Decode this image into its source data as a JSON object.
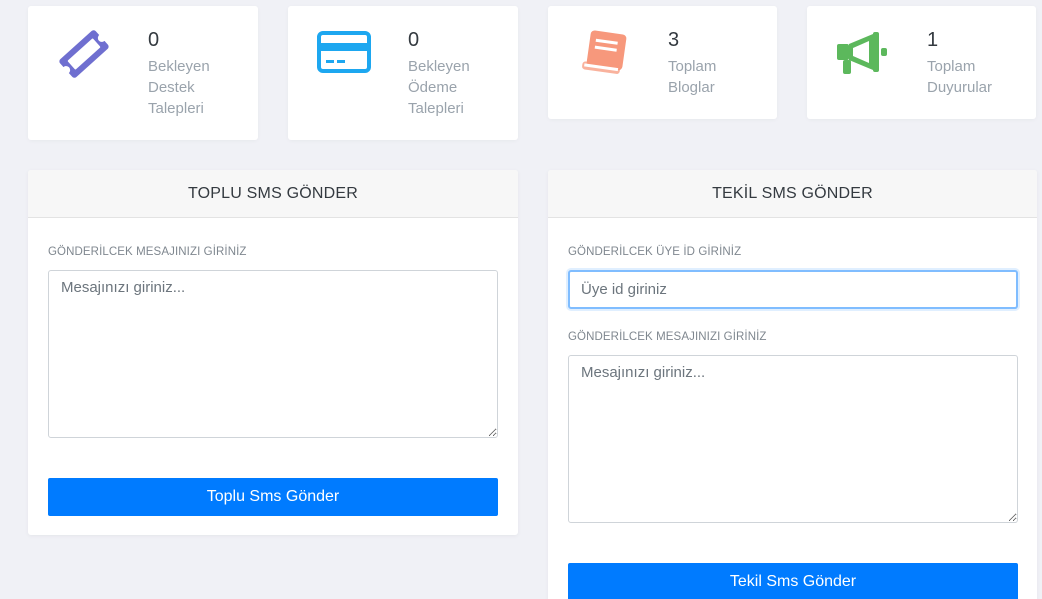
{
  "stats": [
    {
      "value": "0",
      "label_lines": [
        "Bekleyen",
        "Destek",
        "Talepleri"
      ],
      "icon": "ticket-icon",
      "color": "#6f6fd0"
    },
    {
      "value": "0",
      "label_lines": [
        "Bekleyen",
        "Ödeme",
        "Talepleri"
      ],
      "icon": "credit-card-icon",
      "color": "#1da7f0"
    },
    {
      "value": "3",
      "label_lines": [
        "Toplam",
        "Bloglar"
      ],
      "icon": "book-icon",
      "color": "#f7987c"
    },
    {
      "value": "1",
      "label_lines": [
        "Toplam",
        "Duyurular"
      ],
      "icon": "megaphone-icon",
      "color": "#5cb85c"
    }
  ],
  "bulk_sms": {
    "title": "TOPLU SMS GÖNDER",
    "message_label": "GÖNDERİLCEK MESAJINIZI GİRİNİZ",
    "message_placeholder": "Mesajınızı giriniz...",
    "button_label": "Toplu Sms Gönder"
  },
  "single_sms": {
    "title": "TEKİL SMS GÖNDER",
    "user_id_label": "GÖNDERİLCEK ÜYE İD GİRİNİZ",
    "user_id_placeholder": "Üye id giriniz",
    "message_label": "GÖNDERİLCEK MESAJINIZI GİRİNİZ",
    "message_placeholder": "Mesajınızı giriniz...",
    "button_label": "Tekil Sms Gönder"
  },
  "colors": {
    "accent": "#007bff",
    "background": "#f0f1f6"
  }
}
